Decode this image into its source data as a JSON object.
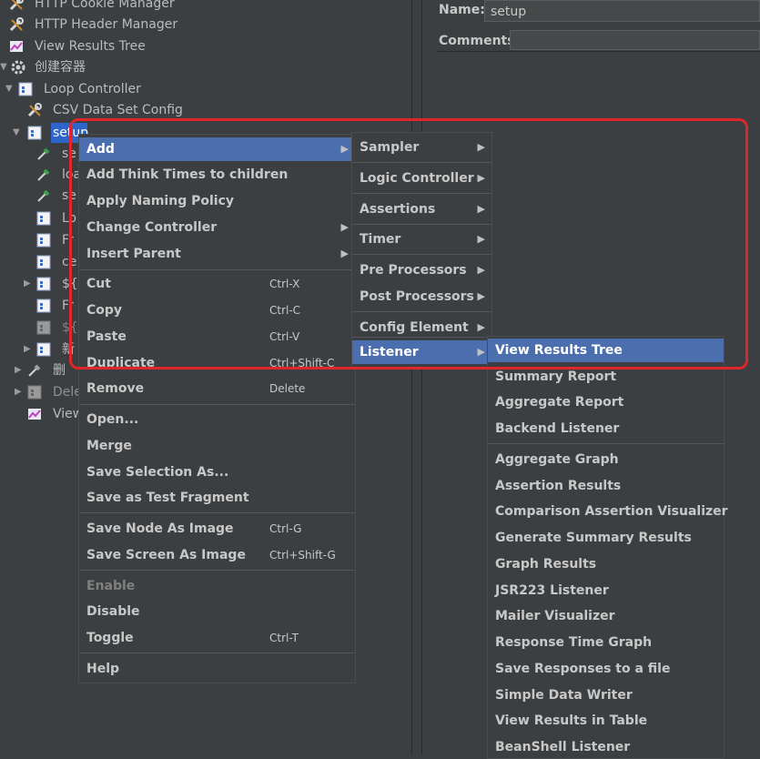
{
  "tree": {
    "items": [
      {
        "label": "HTTP Cookie Manager",
        "icon": "wrench-icon"
      },
      {
        "label": "HTTP Header Manager",
        "icon": "wrench-icon"
      },
      {
        "label": "View Results Tree",
        "icon": "chart-icon"
      },
      {
        "label": "创建容器",
        "icon": "gear-icon"
      },
      {
        "label": "Loop Controller",
        "icon": "controller-icon"
      },
      {
        "label": "CSV Data Set Config",
        "icon": "wrench-icon"
      },
      {
        "label": "setup",
        "icon": "controller-icon"
      },
      {
        "label": "se",
        "icon": "pipette-icon"
      },
      {
        "label": "loa",
        "icon": "pipette-icon"
      },
      {
        "label": "se",
        "icon": "pipette-icon"
      },
      {
        "label": "Lo",
        "icon": "controller-icon"
      },
      {
        "label": "Fr",
        "icon": "controller-icon"
      },
      {
        "label": "ce",
        "icon": "controller-icon"
      },
      {
        "label": "${c",
        "icon": "controller-icon"
      },
      {
        "label": "Fr",
        "icon": "controller-icon"
      },
      {
        "label": "${c",
        "icon": "controller-icon"
      },
      {
        "label": "新",
        "icon": "controller-icon"
      },
      {
        "label": "删",
        "icon": "pipette-icon"
      },
      {
        "label": "Dele",
        "icon": "controller-icon"
      },
      {
        "label": "View",
        "icon": "chart-icon"
      }
    ]
  },
  "right_panel": {
    "name_label": "Name:",
    "name_value": "setup",
    "comments_label": "Comments:"
  },
  "context_menu": {
    "items": [
      {
        "label": "Add",
        "shortcut": "",
        "arrow": "▶"
      },
      {
        "label": "Add Think Times to children",
        "shortcut": "",
        "arrow": ""
      },
      {
        "label": "Apply Naming Policy",
        "shortcut": "",
        "arrow": ""
      },
      {
        "label": "Change Controller",
        "shortcut": "",
        "arrow": "▶"
      },
      {
        "label": "Insert Parent",
        "shortcut": "",
        "arrow": "▶"
      },
      {
        "label": "Cut",
        "shortcut": "Ctrl-X",
        "arrow": ""
      },
      {
        "label": "Copy",
        "shortcut": "Ctrl-C",
        "arrow": ""
      },
      {
        "label": "Paste",
        "shortcut": "Ctrl-V",
        "arrow": ""
      },
      {
        "label": "Duplicate",
        "shortcut": "Ctrl+Shift-C",
        "arrow": ""
      },
      {
        "label": "Remove",
        "shortcut": "Delete",
        "arrow": ""
      },
      {
        "label": "Open...",
        "shortcut": "",
        "arrow": ""
      },
      {
        "label": "Merge",
        "shortcut": "",
        "arrow": ""
      },
      {
        "label": "Save Selection As...",
        "shortcut": "",
        "arrow": ""
      },
      {
        "label": "Save as Test Fragment",
        "shortcut": "",
        "arrow": ""
      },
      {
        "label": "Save Node As Image",
        "shortcut": "Ctrl-G",
        "arrow": ""
      },
      {
        "label": "Save Screen As Image",
        "shortcut": "Ctrl+Shift-G",
        "arrow": ""
      },
      {
        "label": "Enable",
        "shortcut": "",
        "arrow": ""
      },
      {
        "label": "Disable",
        "shortcut": "",
        "arrow": ""
      },
      {
        "label": "Toggle",
        "shortcut": "Ctrl-T",
        "arrow": ""
      },
      {
        "label": "Help",
        "shortcut": "",
        "arrow": ""
      }
    ]
  },
  "add_submenu": {
    "items": [
      {
        "label": "Sampler",
        "arrow": "▶"
      },
      {
        "label": "Logic Controller",
        "arrow": "▶"
      },
      {
        "label": "Assertions",
        "arrow": "▶"
      },
      {
        "label": "Timer",
        "arrow": "▶"
      },
      {
        "label": "Pre Processors",
        "arrow": "▶"
      },
      {
        "label": "Post Processors",
        "arrow": "▶"
      },
      {
        "label": "Config Element",
        "arrow": "▶"
      },
      {
        "label": "Listener",
        "arrow": "▶"
      }
    ]
  },
  "listener_submenu": {
    "items": [
      {
        "label": "View Results Tree"
      },
      {
        "label": "Summary Report"
      },
      {
        "label": "Aggregate Report"
      },
      {
        "label": "Backend Listener"
      },
      {
        "label": "Aggregate Graph"
      },
      {
        "label": "Assertion Results"
      },
      {
        "label": "Comparison Assertion Visualizer"
      },
      {
        "label": "Generate Summary Results"
      },
      {
        "label": "Graph Results"
      },
      {
        "label": "JSR223 Listener"
      },
      {
        "label": "Mailer Visualizer"
      },
      {
        "label": "Response Time Graph"
      },
      {
        "label": "Save Responses to a file"
      },
      {
        "label": "Simple Data Writer"
      },
      {
        "label": "View Results in Table"
      },
      {
        "label": "BeanShell Listener"
      }
    ]
  },
  "colors": {
    "background": "#3c3f41",
    "menu_highlight": "#4b6eaf",
    "tree_selection": "#2f65ca",
    "annotation_red": "#e0262a"
  }
}
